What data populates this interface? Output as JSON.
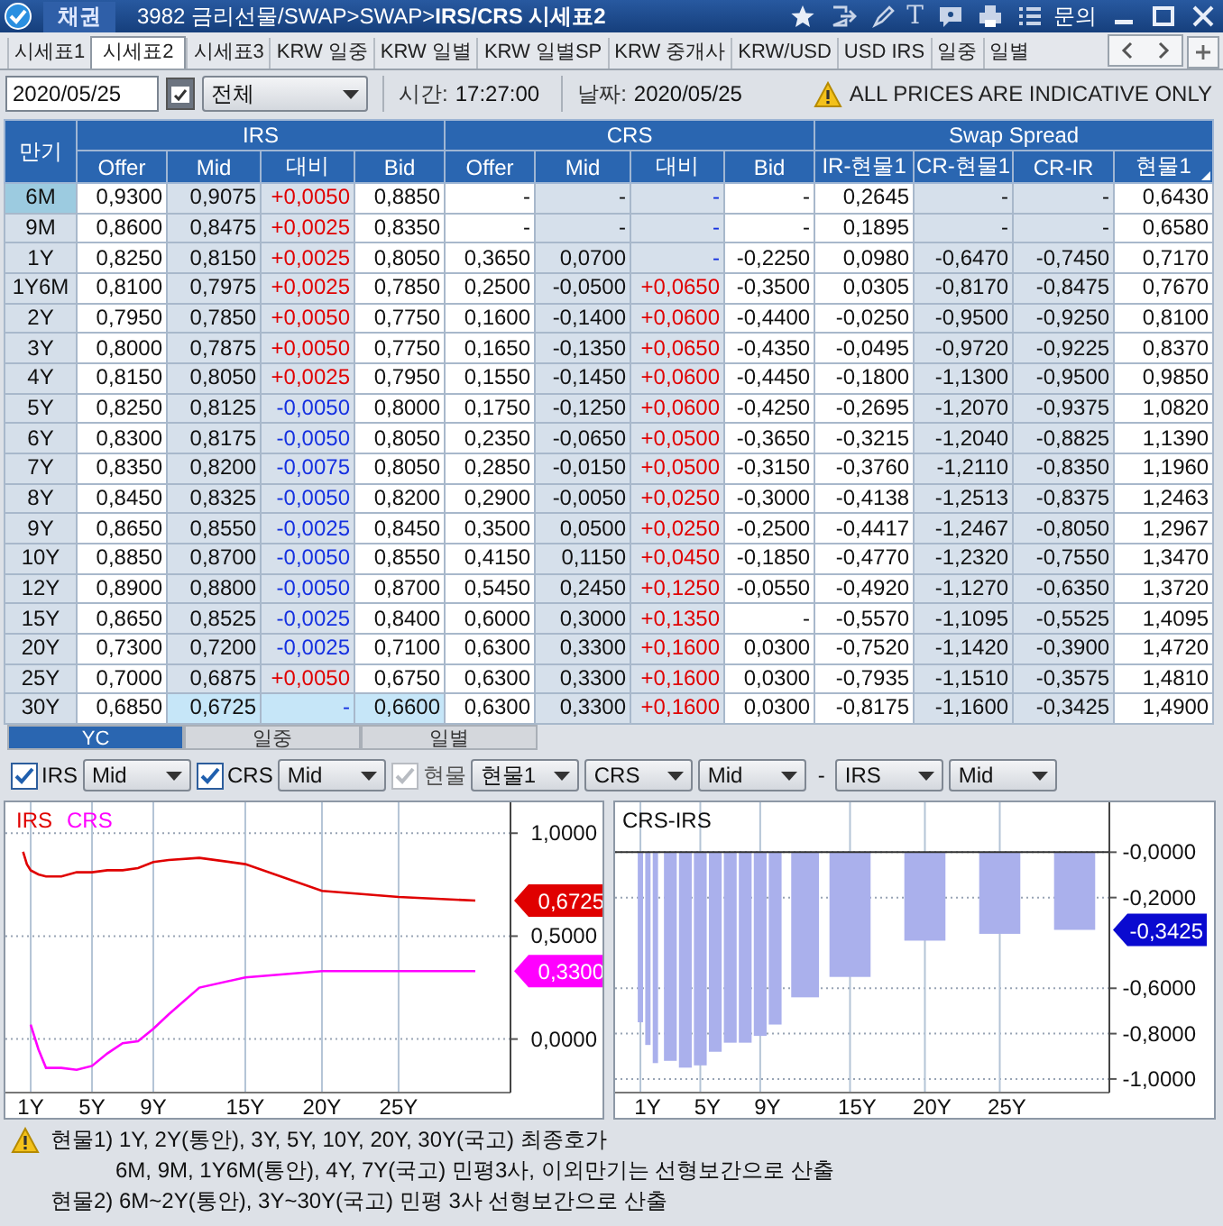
{
  "window": {
    "app": "채권",
    "title": "3982 금리선물/SWAP>SWAP>**IRS/CRS 시세표2**",
    "tool_glyph": "T",
    "help": "문의"
  },
  "tabs": [
    {
      "label": "시세표1",
      "selected": false
    },
    {
      "label": "시세표2",
      "selected": true
    },
    {
      "label": "시세표3",
      "selected": false
    },
    {
      "label": "KRW 일중",
      "selected": false
    },
    {
      "label": "KRW 일별",
      "selected": false
    },
    {
      "label": "KRW 일별SP",
      "selected": false
    },
    {
      "label": "KRW 중개사",
      "selected": false
    },
    {
      "label": "KRW/USD",
      "selected": false
    },
    {
      "label": "USD IRS",
      "selected": false
    },
    {
      "label": "일중",
      "selected": false
    },
    {
      "label": "일별",
      "selected": false
    }
  ],
  "toolbar": {
    "date": "2020/05/25",
    "filter": "전체",
    "time_label": "시간:",
    "time": "17:27:00",
    "date_label": "날짜:",
    "date_value": "2020/05/25",
    "notice": "ALL PRICES ARE INDICATIVE ONLY"
  },
  "table": {
    "tenor_header": "만기",
    "groups": [
      "IRS",
      "CRS",
      "Swap Spread"
    ],
    "columns": [
      "Offer",
      "Mid",
      "대비",
      "Bid",
      "Offer",
      "Mid",
      "대비",
      "Bid",
      "IR-현물1",
      "CR-현물1",
      "CR-IR",
      "현물1"
    ],
    "rows": [
      {
        "tenor": "6M",
        "selected": true,
        "flash": false,
        "irs_up": true,
        "crs_up": false,
        "cells": [
          "0,9300",
          "0,9075",
          "+0,0050",
          "0,8850",
          "-",
          "-",
          "-",
          "-",
          "0,2645",
          "-",
          "-",
          "0,6430"
        ]
      },
      {
        "tenor": "9M",
        "selected": false,
        "flash": false,
        "irs_up": true,
        "crs_up": false,
        "cells": [
          "0,8600",
          "0,8475",
          "+0,0025",
          "0,8350",
          "-",
          "-",
          "-",
          "-",
          "0,1895",
          "-",
          "-",
          "0,6580"
        ]
      },
      {
        "tenor": "1Y",
        "selected": false,
        "flash": false,
        "irs_up": true,
        "crs_up": false,
        "cells": [
          "0,8250",
          "0,8150",
          "+0,0025",
          "0,8050",
          "0,3650",
          "0,0700",
          "-",
          "-0,2250",
          "0,0980",
          "-0,6470",
          "-0,7450",
          "0,7170"
        ]
      },
      {
        "tenor": "1Y6M",
        "selected": false,
        "flash": false,
        "irs_up": true,
        "crs_up": true,
        "cells": [
          "0,8100",
          "0,7975",
          "+0,0025",
          "0,7850",
          "0,2500",
          "-0,0500",
          "+0,0650",
          "-0,3500",
          "0,0305",
          "-0,8170",
          "-0,8475",
          "0,7670"
        ]
      },
      {
        "tenor": "2Y",
        "selected": false,
        "flash": false,
        "irs_up": true,
        "crs_up": true,
        "cells": [
          "0,7950",
          "0,7850",
          "+0,0050",
          "0,7750",
          "0,1600",
          "-0,1400",
          "+0,0600",
          "-0,4400",
          "-0,0250",
          "-0,9500",
          "-0,9250",
          "0,8100"
        ]
      },
      {
        "tenor": "3Y",
        "selected": false,
        "flash": false,
        "irs_up": true,
        "crs_up": true,
        "cells": [
          "0,8000",
          "0,7875",
          "+0,0050",
          "0,7750",
          "0,1650",
          "-0,1350",
          "+0,0650",
          "-0,4350",
          "-0,0495",
          "-0,9720",
          "-0,9225",
          "0,8370"
        ]
      },
      {
        "tenor": "4Y",
        "selected": false,
        "flash": false,
        "irs_up": true,
        "crs_up": true,
        "cells": [
          "0,8150",
          "0,8050",
          "+0,0025",
          "0,7950",
          "0,1550",
          "-0,1450",
          "+0,0600",
          "-0,4450",
          "-0,1800",
          "-1,1300",
          "-0,9500",
          "0,9850"
        ]
      },
      {
        "tenor": "5Y",
        "selected": false,
        "flash": false,
        "irs_up": false,
        "crs_up": true,
        "cells": [
          "0,8250",
          "0,8125",
          "-0,0050",
          "0,8000",
          "0,1750",
          "-0,1250",
          "+0,0600",
          "-0,4250",
          "-0,2695",
          "-1,2070",
          "-0,9375",
          "1,0820"
        ]
      },
      {
        "tenor": "6Y",
        "selected": false,
        "flash": false,
        "irs_up": false,
        "crs_up": true,
        "cells": [
          "0,8300",
          "0,8175",
          "-0,0050",
          "0,8050",
          "0,2350",
          "-0,0650",
          "+0,0500",
          "-0,3650",
          "-0,3215",
          "-1,2040",
          "-0,8825",
          "1,1390"
        ]
      },
      {
        "tenor": "7Y",
        "selected": false,
        "flash": false,
        "irs_up": false,
        "crs_up": true,
        "cells": [
          "0,8350",
          "0,8200",
          "-0,0075",
          "0,8050",
          "0,2850",
          "-0,0150",
          "+0,0500",
          "-0,3150",
          "-0,3760",
          "-1,2110",
          "-0,8350",
          "1,1960"
        ]
      },
      {
        "tenor": "8Y",
        "selected": false,
        "flash": false,
        "irs_up": false,
        "crs_up": true,
        "cells": [
          "0,8450",
          "0,8325",
          "-0,0050",
          "0,8200",
          "0,2900",
          "-0,0050",
          "+0,0250",
          "-0,3000",
          "-0,4138",
          "-1,2513",
          "-0,8375",
          "1,2463"
        ]
      },
      {
        "tenor": "9Y",
        "selected": false,
        "flash": false,
        "irs_up": false,
        "crs_up": true,
        "cells": [
          "0,8650",
          "0,8550",
          "-0,0025",
          "0,8450",
          "0,3500",
          "0,0500",
          "+0,0250",
          "-0,2500",
          "-0,4417",
          "-1,2467",
          "-0,8050",
          "1,2967"
        ]
      },
      {
        "tenor": "10Y",
        "selected": false,
        "flash": false,
        "irs_up": false,
        "crs_up": true,
        "cells": [
          "0,8850",
          "0,8700",
          "-0,0050",
          "0,8550",
          "0,4150",
          "0,1150",
          "+0,0450",
          "-0,1850",
          "-0,4770",
          "-1,2320",
          "-0,7550",
          "1,3470"
        ]
      },
      {
        "tenor": "12Y",
        "selected": false,
        "flash": false,
        "irs_up": false,
        "crs_up": true,
        "cells": [
          "0,8900",
          "0,8800",
          "-0,0050",
          "0,8700",
          "0,5450",
          "0,2450",
          "+0,1250",
          "-0,0550",
          "-0,4920",
          "-1,1270",
          "-0,6350",
          "1,3720"
        ]
      },
      {
        "tenor": "15Y",
        "selected": false,
        "flash": false,
        "irs_up": false,
        "crs_up": true,
        "cells": [
          "0,8650",
          "0,8525",
          "-0,0025",
          "0,8400",
          "0,6000",
          "0,3000",
          "+0,1350",
          "-",
          "-0,5570",
          "-1,1095",
          "-0,5525",
          "1,4095"
        ]
      },
      {
        "tenor": "20Y",
        "selected": false,
        "flash": false,
        "irs_up": false,
        "crs_up": true,
        "cells": [
          "0,7300",
          "0,7200",
          "-0,0025",
          "0,7100",
          "0,6300",
          "0,3300",
          "+0,1600",
          "0,0300",
          "-0,7520",
          "-1,1420",
          "-0,3900",
          "1,4720"
        ]
      },
      {
        "tenor": "25Y",
        "selected": false,
        "flash": false,
        "irs_up": true,
        "crs_up": true,
        "cells": [
          "0,7000",
          "0,6875",
          "+0,0050",
          "0,6750",
          "0,6300",
          "0,3300",
          "+0,1600",
          "0,0300",
          "-0,7935",
          "-1,1510",
          "-0,3575",
          "1,4810"
        ]
      },
      {
        "tenor": "30Y",
        "selected": false,
        "flash": true,
        "irs_up": false,
        "crs_up": true,
        "cells": [
          "0,6850",
          "0,6725",
          "-",
          "0,6600",
          "0,6300",
          "0,3300",
          "+0,1600",
          "0,0300",
          "-0,8175",
          "-1,1600",
          "-0,3425",
          "1,4900"
        ]
      }
    ]
  },
  "bottom": {
    "tabs": [
      {
        "label": "YC",
        "selected": true
      },
      {
        "label": "일중",
        "selected": false
      },
      {
        "label": "일별",
        "selected": false
      }
    ],
    "controls": [
      {
        "kind": "checkbox",
        "label": "IRS",
        "checked": true,
        "disabled": false
      },
      {
        "kind": "select",
        "value": "Mid"
      },
      {
        "kind": "checkbox",
        "label": "CRS",
        "checked": true,
        "disabled": false
      },
      {
        "kind": "select",
        "value": "Mid"
      },
      {
        "kind": "checkbox",
        "label": "현물",
        "checked": true,
        "disabled": true
      },
      {
        "kind": "select",
        "value": "현물1"
      },
      {
        "kind": "select",
        "value": "CRS"
      },
      {
        "kind": "select",
        "value": "Mid"
      },
      {
        "kind": "text",
        "label": "-"
      },
      {
        "kind": "select",
        "value": "IRS"
      },
      {
        "kind": "select",
        "value": "Mid"
      }
    ],
    "charts": [
      {
        "chart_data": {
          "type": "line",
          "x": [
            0.5,
            0.75,
            1,
            1.5,
            2,
            3,
            4,
            5,
            6,
            7,
            8,
            9,
            10,
            12,
            15,
            20,
            25,
            30
          ],
          "series": [
            {
              "name": "IRS",
              "color": "#e00000",
              "values": [
                0.91,
                0.85,
                0.82,
                0.8,
                0.79,
                0.79,
                0.81,
                0.81,
                0.82,
                0.82,
                0.83,
                0.86,
                0.87,
                0.88,
                0.85,
                0.72,
                0.69,
                0.6725
              ]
            },
            {
              "name": "CRS",
              "color": "#ff00ff",
              "values": [
                null,
                null,
                0.07,
                -0.05,
                -0.14,
                -0.14,
                -0.15,
                -0.13,
                -0.07,
                -0.02,
                -0.01,
                0.05,
                0.12,
                0.25,
                0.3,
                0.33,
                0.33,
                0.33
              ]
            }
          ],
          "xlim": [
            -0.65,
            32.3
          ],
          "ylim": [
            -0.26,
            1.15
          ],
          "grid": true,
          "xticks": [
            {
              "value": 1,
              "label": "1Y"
            },
            {
              "value": 5,
              "label": "5Y"
            },
            {
              "value": 9,
              "label": "9Y"
            },
            {
              "value": 15,
              "label": "15Y"
            },
            {
              "value": 20,
              "label": "20Y"
            },
            {
              "value": 25,
              "label": "25Y"
            }
          ],
          "yticks": [
            {
              "value": 1,
              "label": "1,0000"
            },
            {
              "value": 0.5,
              "label": "0,5000"
            },
            {
              "value": 0,
              "label": "0,0000"
            }
          ],
          "annotations": [
            "0,6725",
            "0,3300"
          ]
        }
      },
      {
        "chart_data": {
          "type": "bar",
          "title": "CRS-IRS",
          "x": [
            1,
            1.5,
            2,
            3,
            4,
            5,
            6,
            7,
            8,
            9,
            10,
            12,
            15,
            20,
            25,
            30
          ],
          "values": [
            -0.75,
            -0.85,
            -0.93,
            -0.92,
            -0.95,
            -0.94,
            -0.88,
            -0.84,
            -0.84,
            -0.81,
            -0.76,
            -0.64,
            -0.55,
            -0.39,
            -0.36,
            -0.3425
          ],
          "xlim": [
            -0.69,
            32.32
          ],
          "ylim": [
            -1.06,
            0.22
          ],
          "grid": true,
          "xticks": [
            {
              "value": 1,
              "label": "1Y"
            },
            {
              "value": 5,
              "label": "5Y"
            },
            {
              "value": 9,
              "label": "9Y"
            },
            {
              "value": 15,
              "label": "15Y"
            },
            {
              "value": 20,
              "label": "20Y"
            },
            {
              "value": 25,
              "label": "25Y"
            }
          ],
          "yticks": [
            {
              "value": 0,
              "label": "-0,0000"
            },
            {
              "value": -0.2,
              "label": "-0,2000"
            },
            {
              "value": -0.6,
              "label": "-0,6000"
            },
            {
              "value": -0.8,
              "label": "-0,8000"
            },
            {
              "value": -1,
              "label": "-1,0000"
            }
          ],
          "annotations": [
            "-0,3425"
          ]
        }
      }
    ]
  },
  "notes": [
    {
      "kind": "warning",
      "text": "현물1) 1Y, 2Y(통안), 3Y, 5Y, 10Y, 20Y, 30Y(국고) 최종호가"
    },
    {
      "kind": "continuation",
      "text": "6M, 9M, 1Y6M(통안), 4Y, 7Y(국고) 민평3사, 이외만기는 선형보간으로 산출"
    },
    {
      "kind": "plain",
      "text": "현물2) 6M~2Y(통안), 3Y~30Y(국고) 민평 3사 선형보간으로 산출"
    }
  ]
}
